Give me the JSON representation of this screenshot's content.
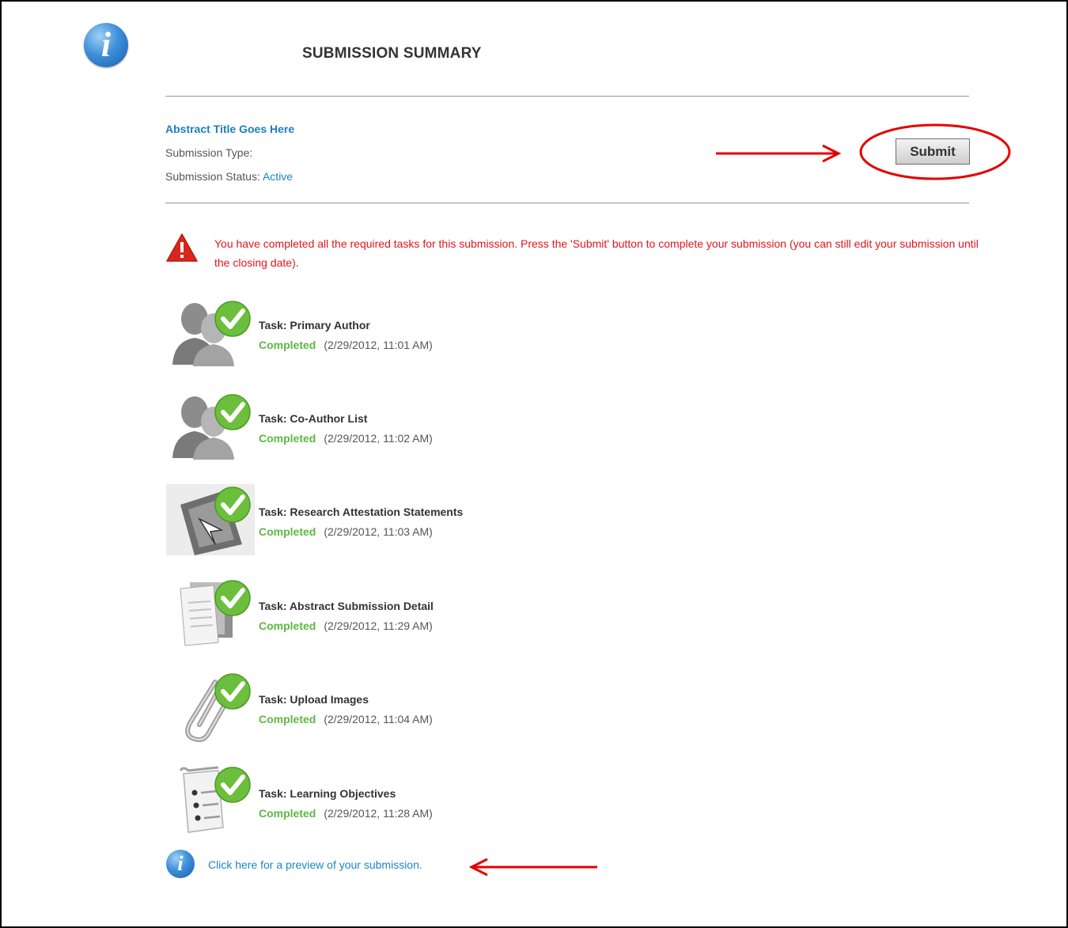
{
  "page": {
    "title": "SUBMISSION SUMMARY"
  },
  "summary": {
    "abstract_title": "Abstract Title Goes Here",
    "type_label": "Submission Type:",
    "type_value": "",
    "status_label": "Submission Status:",
    "status_value": "Active"
  },
  "submit_label": "Submit",
  "warning": "You have completed all the required tasks for this submission. Press the 'Submit' button to complete your submission (you can still edit your submission until the closing date).",
  "tasks": [
    {
      "name": "Task: Primary Author",
      "status": "Completed",
      "date": "(2/29/2012, 11:01 AM)",
      "icon": "authors-icon"
    },
    {
      "name": "Task: Co-Author List",
      "status": "Completed",
      "date": "(2/29/2012, 11:02 AM)",
      "icon": "authors-icon"
    },
    {
      "name": "Task: Research Attestation Statements",
      "status": "Completed",
      "date": "(2/29/2012, 11:03 AM)",
      "icon": "cursor-icon"
    },
    {
      "name": "Task: Abstract Submission Detail",
      "status": "Completed",
      "date": "(2/29/2012, 11:29 AM)",
      "icon": "documents-icon"
    },
    {
      "name": "Task: Upload Images",
      "status": "Completed",
      "date": "(2/29/2012, 11:04 AM)",
      "icon": "paperclip-icon"
    },
    {
      "name": "Task: Learning Objectives",
      "status": "Completed",
      "date": "(2/29/2012, 11:28 AM)",
      "icon": "checklist-icon"
    }
  ],
  "preview_link": "Click here for a preview of your submission.",
  "colors": {
    "accent": "#1a86c7",
    "warning": "#e5141a",
    "completed": "#5db843",
    "annotation": "#e60000"
  }
}
